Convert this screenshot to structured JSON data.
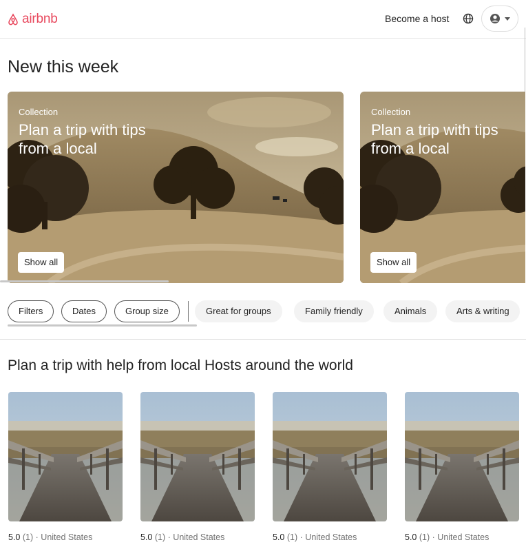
{
  "header": {
    "logo_text": "airbnb",
    "become_host": "Become a host"
  },
  "new_week": {
    "title": "New this week",
    "cards": [
      {
        "kicker": "Collection",
        "title": "Plan a trip with tips from a local",
        "button": "Show all"
      },
      {
        "kicker": "Collection",
        "title": "Plan a trip with tips from a local",
        "button": "Show all"
      }
    ]
  },
  "filters": {
    "outline": [
      "Filters",
      "Dates",
      "Group size"
    ],
    "categories": [
      "Great for groups",
      "Family friendly",
      "Animals",
      "Arts & writing"
    ]
  },
  "experiences": {
    "title": "Plan a trip with help from local Hosts around the world",
    "items": [
      {
        "rating": "5.0",
        "reviews": "(1)",
        "sep": "·",
        "location": "United States"
      },
      {
        "rating": "5.0",
        "reviews": "(1)",
        "sep": "·",
        "location": "United States"
      },
      {
        "rating": "5.0",
        "reviews": "(1)",
        "sep": "·",
        "location": "United States"
      },
      {
        "rating": "5.0",
        "reviews": "(1)",
        "sep": "·",
        "location": "United States"
      }
    ]
  },
  "colors": {
    "brand": "#e8485d"
  }
}
